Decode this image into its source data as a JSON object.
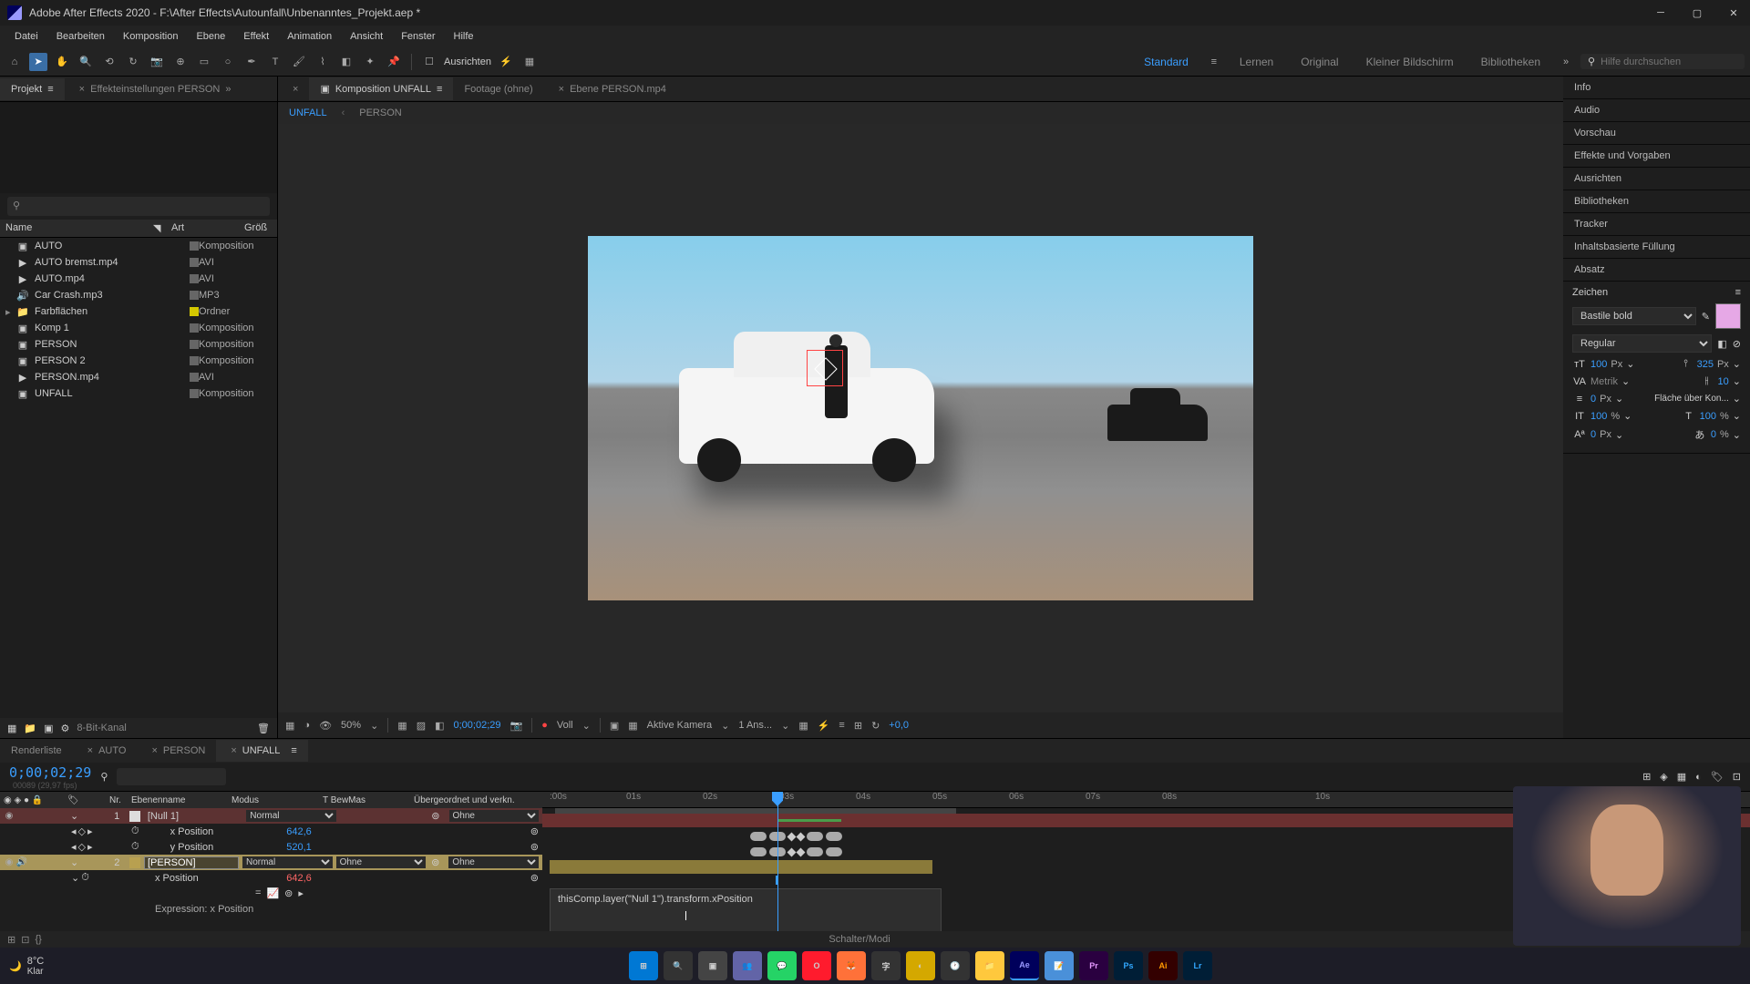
{
  "titlebar": {
    "title": "Adobe After Effects 2020 - F:\\After Effects\\Autounfall\\Unbenanntes_Projekt.aep *"
  },
  "menubar": [
    "Datei",
    "Bearbeiten",
    "Komposition",
    "Ebene",
    "Effekt",
    "Animation",
    "Ansicht",
    "Fenster",
    "Hilfe"
  ],
  "toolbar": {
    "align_label": "Ausrichten",
    "workspaces": [
      "Standard",
      "Lernen",
      "Original",
      "Kleiner Bildschirm",
      "Bibliotheken"
    ],
    "active_workspace": 0,
    "search_placeholder": "Hilfe durchsuchen"
  },
  "project_panel": {
    "tabs": [
      {
        "label": "Projekt",
        "active": true
      },
      {
        "label": "Effekteinstellungen PERSON",
        "active": false
      }
    ],
    "headers": {
      "name": "Name",
      "type": "Art",
      "size": "Größ"
    },
    "items": [
      {
        "name": "AUTO",
        "type": "Komposition",
        "icon": "comp",
        "label": "grey"
      },
      {
        "name": "AUTO bremst.mp4",
        "type": "AVI",
        "icon": "video",
        "label": "grey"
      },
      {
        "name": "AUTO.mp4",
        "type": "AVI",
        "icon": "video",
        "label": "grey"
      },
      {
        "name": "Car Crash.mp3",
        "type": "MP3",
        "icon": "audio",
        "label": "grey"
      },
      {
        "name": "Farbflächen",
        "type": "Ordner",
        "icon": "folder",
        "label": "yellow",
        "expandable": true
      },
      {
        "name": "Komp 1",
        "type": "Komposition",
        "icon": "comp",
        "label": "grey"
      },
      {
        "name": "PERSON",
        "type": "Komposition",
        "icon": "comp",
        "label": "grey"
      },
      {
        "name": "PERSON 2",
        "type": "Komposition",
        "icon": "comp",
        "label": "grey"
      },
      {
        "name": "PERSON.mp4",
        "type": "AVI",
        "icon": "video",
        "label": "grey"
      },
      {
        "name": "UNFALL",
        "type": "Komposition",
        "icon": "comp",
        "label": "grey"
      }
    ],
    "footer": "8-Bit-Kanal"
  },
  "comp_panel": {
    "tabs": [
      {
        "label": "Komposition UNFALL",
        "active": true,
        "prefix_icon": "comp"
      },
      {
        "label": "Footage (ohne)",
        "active": false
      },
      {
        "label": "Ebene PERSON.mp4",
        "active": false
      }
    ],
    "subtabs": [
      {
        "label": "UNFALL",
        "active": true
      },
      {
        "label": "PERSON",
        "active": false
      }
    ],
    "controls": {
      "zoom": "50%",
      "time": "0;00;02;29",
      "resolution": "Voll",
      "camera": "Aktive Kamera",
      "views": "1 Ans...",
      "exposure": "+0,0"
    }
  },
  "right_panels": {
    "collapsed": [
      "Info",
      "Audio",
      "Vorschau",
      "Effekte und Vorgaben",
      "Ausrichten",
      "Bibliotheken",
      "Tracker",
      "Inhaltsbasierte Füllung",
      "Absatz"
    ],
    "character": {
      "title": "Zeichen",
      "font": "Bastile bold",
      "style": "Regular",
      "size": "100",
      "size_unit": "Px",
      "leading": "325",
      "leading_unit": "Px",
      "kerning": "Metrik",
      "tracking": "10",
      "stroke": "0",
      "stroke_unit": "Px",
      "stroke_mode": "Fläche über Kon...",
      "vscale": "100",
      "vscale_unit": "%",
      "hscale": "100",
      "hscale_unit": "%",
      "baseline": "0",
      "baseline_unit": "Px",
      "tsume": "0",
      "tsume_unit": "%",
      "fill_color": "#e6a8e6"
    }
  },
  "timeline": {
    "tabs": [
      {
        "label": "Renderliste",
        "active": false
      },
      {
        "label": "AUTO",
        "active": false
      },
      {
        "label": "PERSON",
        "active": false
      },
      {
        "label": "UNFALL",
        "active": true
      }
    ],
    "timecode": "0;00;02;29",
    "timecode_sub": "00089 (29,97 fps)",
    "col_headers": {
      "num": "Nr.",
      "name": "Ebenenname",
      "mode": "Modus",
      "trkmat": "T  BewMas",
      "parent": "Übergeordnet und verkn."
    },
    "ruler_ticks": [
      ":00s",
      "01s",
      "02s",
      "03s",
      "04s",
      "05s",
      "06s",
      "07s",
      "08s",
      "10s"
    ],
    "layers": [
      {
        "num": "1",
        "name": "[Null 1]",
        "mode": "Normal",
        "parent": "Ohne",
        "color": "red",
        "props": [
          {
            "name": "x Position",
            "value": "642,6"
          },
          {
            "name": "y Position",
            "value": "520,1"
          }
        ]
      },
      {
        "num": "2",
        "name": "[PERSON]",
        "mode": "Normal",
        "trkmat": "Ohne",
        "parent": "Ohne",
        "color": "tan",
        "selected": true,
        "props": [
          {
            "name": "x Position",
            "value": "642,6"
          }
        ],
        "expression": {
          "label": "Expression: x Position",
          "code": "thisComp.layer(\"Null 1\").transform.xPosition"
        }
      }
    ],
    "footer": "Schalter/Modi"
  },
  "taskbar": {
    "weather_temp": "8°C",
    "weather_cond": "Klar",
    "apps": [
      "win",
      "search",
      "tasks",
      "teams",
      "whatsapp",
      "opera",
      "firefox",
      "char",
      "app1",
      "clock",
      "files",
      "ae",
      "app2",
      "pr",
      "ps",
      "ai",
      "lr"
    ]
  }
}
